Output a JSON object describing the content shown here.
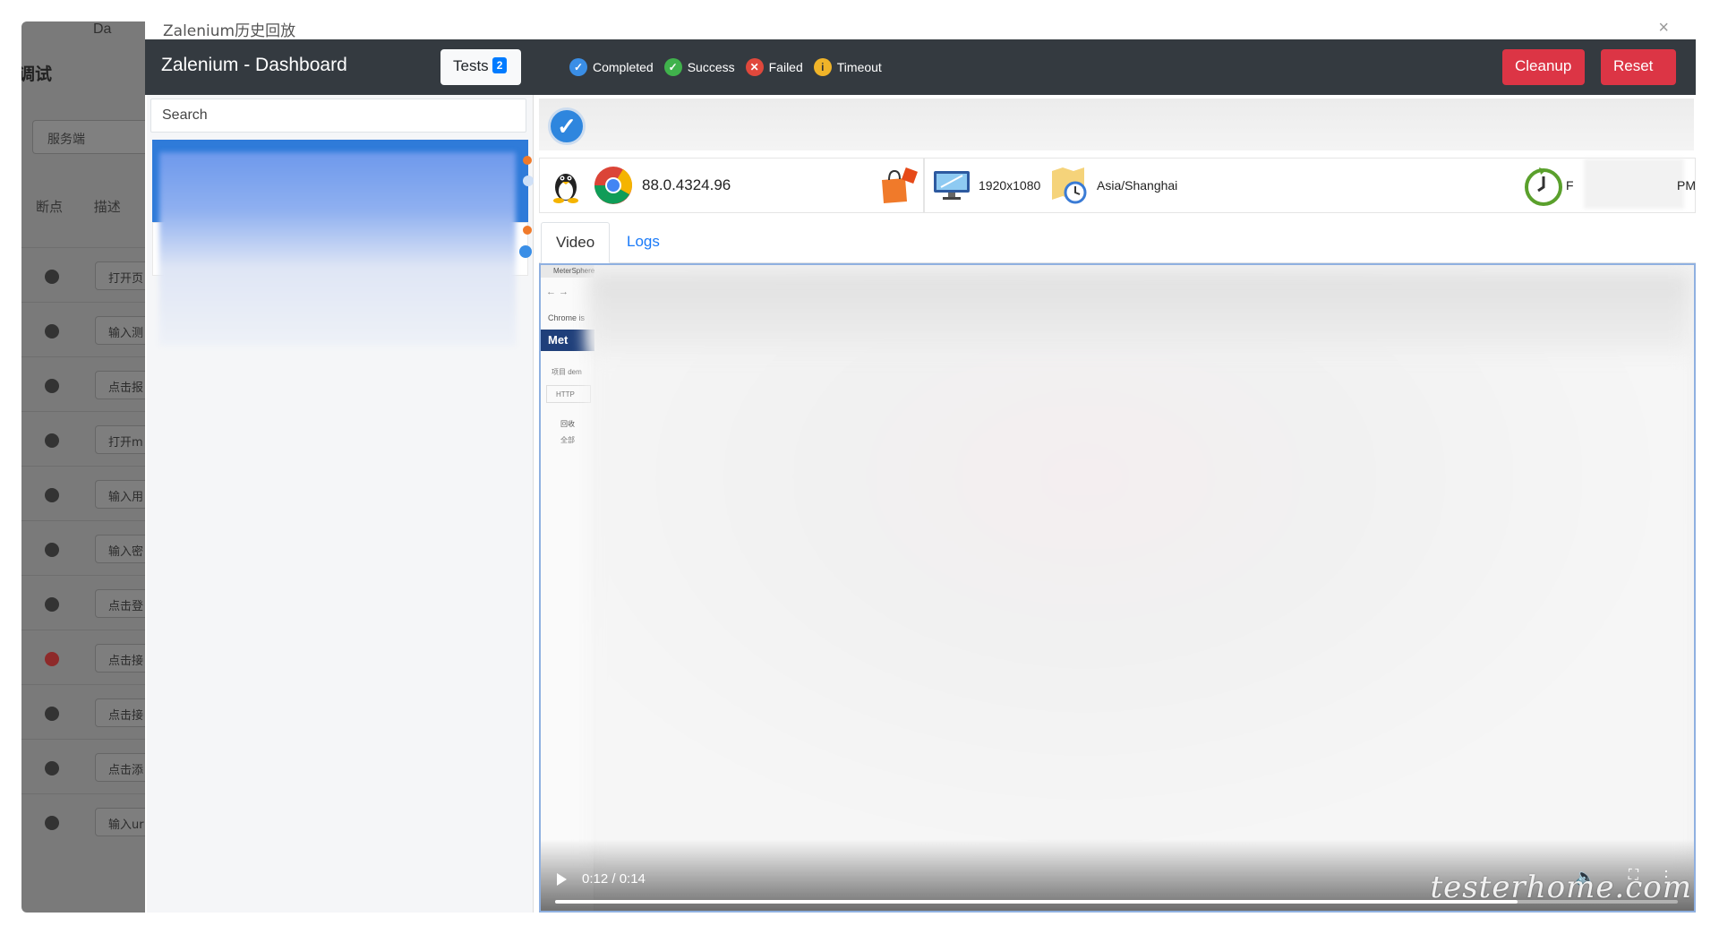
{
  "background_app": {
    "topbar_label": "Da",
    "title": "调试",
    "select_value": "服务端",
    "column_headers": [
      "断点",
      "描述"
    ],
    "rows": [
      {
        "text": "打开页",
        "breakpoint": false
      },
      {
        "text": "输入测",
        "breakpoint": false
      },
      {
        "text": "点击报",
        "breakpoint": false
      },
      {
        "text": "打开m",
        "breakpoint": false
      },
      {
        "text": "输入用",
        "breakpoint": false
      },
      {
        "text": "输入密",
        "breakpoint": false
      },
      {
        "text": "点击登",
        "breakpoint": false
      },
      {
        "text": "点击接",
        "breakpoint": true
      },
      {
        "text": "点击接",
        "breakpoint": false
      },
      {
        "text": "点击添",
        "breakpoint": false
      },
      {
        "text": "输入ur",
        "breakpoint": false
      }
    ]
  },
  "modal": {
    "title": "Zalenium历史回放",
    "close_label": "×"
  },
  "navbar": {
    "brand": "Zalenium - Dashboard",
    "tests_label": "Tests",
    "tests_count": "2",
    "legend": {
      "completed": "Completed",
      "success": "Success",
      "failed": "Failed",
      "timeout": "Timeout"
    },
    "cleanup_label": "Cleanup",
    "reset_label": "Reset"
  },
  "left_panel": {
    "search_placeholder": "Search"
  },
  "test_detail": {
    "browser_version": "88.0.4324.96",
    "resolution": "1920x1080",
    "timezone": "Asia/Shanghai",
    "time_prefix": "F",
    "time_suffix": "PM"
  },
  "tabs": {
    "video": "Video",
    "logs": "Logs"
  },
  "video": {
    "browser_tab_title": "MeterSphere",
    "chrome_notice": "Chrome is",
    "app_logo": "Met",
    "project_label": "项目 dem",
    "protocol_label": "HTTP",
    "tree_items": [
      "回收",
      "全部"
    ],
    "time_display": "0:12 / 0:14",
    "progress_fraction": 0.857
  },
  "watermark": "testerhome.com",
  "colors": {
    "navbar": "#343a40",
    "danger": "#dc3545",
    "primary": "#007bff",
    "active_item": "#2f7bd9"
  }
}
